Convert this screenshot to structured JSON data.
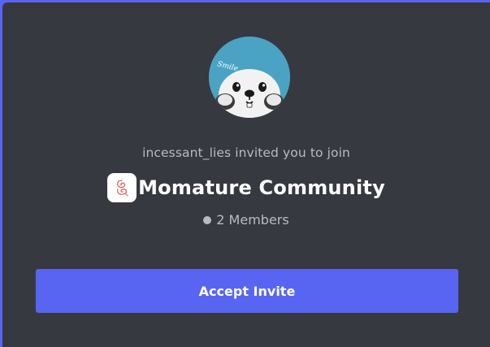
{
  "invite": {
    "inviter_text": "incessant_lies invited you to join",
    "avatar_caption": "Smile",
    "server_name": "Momature Community",
    "member_count": "2 Members",
    "accept_label": "Accept Invite"
  },
  "colors": {
    "backdrop": "#5865f2",
    "card": "#36393f",
    "accent": "#5865f2",
    "muted_text": "#b9bbbe",
    "avatar_bg": "#4aa3c3"
  }
}
